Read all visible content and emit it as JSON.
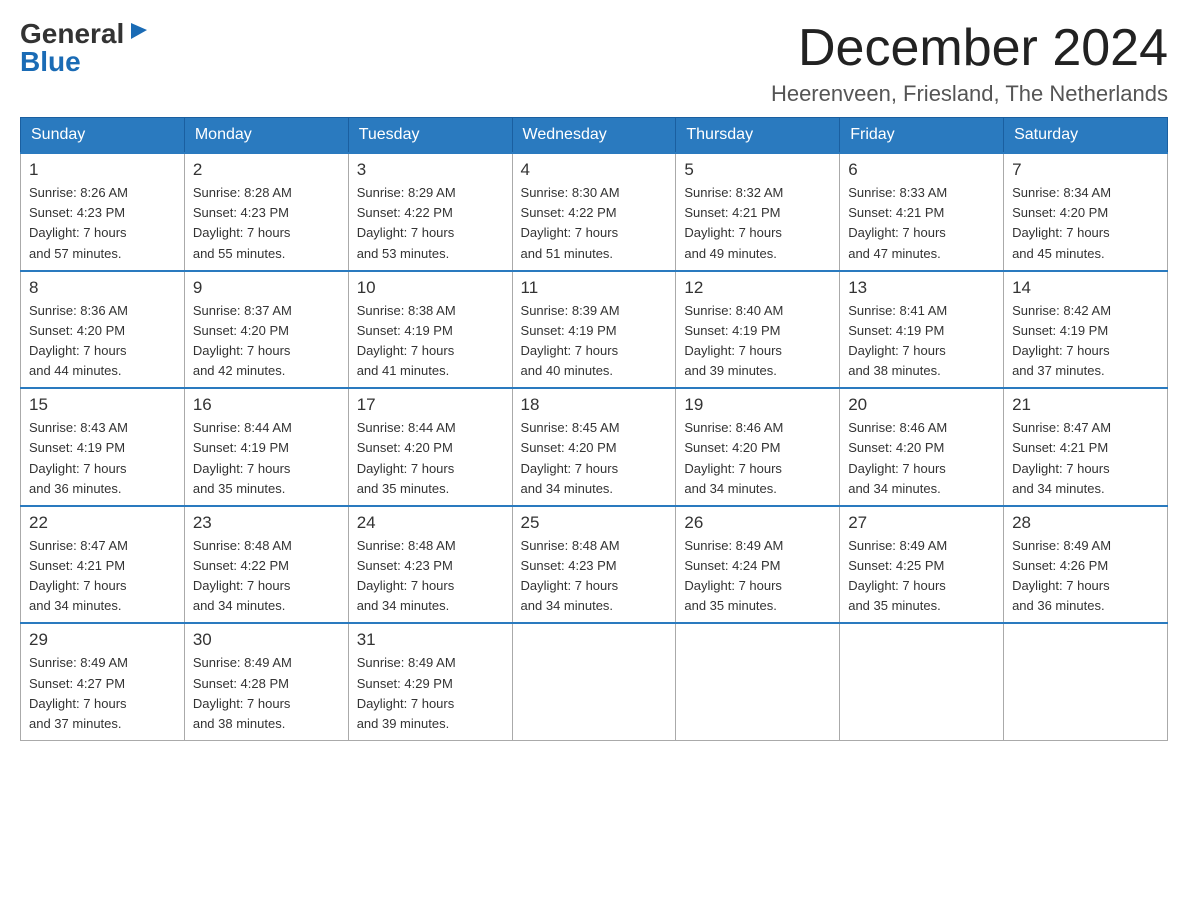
{
  "logo": {
    "general": "General",
    "blue": "Blue",
    "triangle": "▶"
  },
  "title": "December 2024",
  "subtitle": "Heerenveen, Friesland, The Netherlands",
  "headers": [
    "Sunday",
    "Monday",
    "Tuesday",
    "Wednesday",
    "Thursday",
    "Friday",
    "Saturday"
  ],
  "weeks": [
    [
      {
        "day": "1",
        "info": "Sunrise: 8:26 AM\nSunset: 4:23 PM\nDaylight: 7 hours\nand 57 minutes."
      },
      {
        "day": "2",
        "info": "Sunrise: 8:28 AM\nSunset: 4:23 PM\nDaylight: 7 hours\nand 55 minutes."
      },
      {
        "day": "3",
        "info": "Sunrise: 8:29 AM\nSunset: 4:22 PM\nDaylight: 7 hours\nand 53 minutes."
      },
      {
        "day": "4",
        "info": "Sunrise: 8:30 AM\nSunset: 4:22 PM\nDaylight: 7 hours\nand 51 minutes."
      },
      {
        "day": "5",
        "info": "Sunrise: 8:32 AM\nSunset: 4:21 PM\nDaylight: 7 hours\nand 49 minutes."
      },
      {
        "day": "6",
        "info": "Sunrise: 8:33 AM\nSunset: 4:21 PM\nDaylight: 7 hours\nand 47 minutes."
      },
      {
        "day": "7",
        "info": "Sunrise: 8:34 AM\nSunset: 4:20 PM\nDaylight: 7 hours\nand 45 minutes."
      }
    ],
    [
      {
        "day": "8",
        "info": "Sunrise: 8:36 AM\nSunset: 4:20 PM\nDaylight: 7 hours\nand 44 minutes."
      },
      {
        "day": "9",
        "info": "Sunrise: 8:37 AM\nSunset: 4:20 PM\nDaylight: 7 hours\nand 42 minutes."
      },
      {
        "day": "10",
        "info": "Sunrise: 8:38 AM\nSunset: 4:19 PM\nDaylight: 7 hours\nand 41 minutes."
      },
      {
        "day": "11",
        "info": "Sunrise: 8:39 AM\nSunset: 4:19 PM\nDaylight: 7 hours\nand 40 minutes."
      },
      {
        "day": "12",
        "info": "Sunrise: 8:40 AM\nSunset: 4:19 PM\nDaylight: 7 hours\nand 39 minutes."
      },
      {
        "day": "13",
        "info": "Sunrise: 8:41 AM\nSunset: 4:19 PM\nDaylight: 7 hours\nand 38 minutes."
      },
      {
        "day": "14",
        "info": "Sunrise: 8:42 AM\nSunset: 4:19 PM\nDaylight: 7 hours\nand 37 minutes."
      }
    ],
    [
      {
        "day": "15",
        "info": "Sunrise: 8:43 AM\nSunset: 4:19 PM\nDaylight: 7 hours\nand 36 minutes."
      },
      {
        "day": "16",
        "info": "Sunrise: 8:44 AM\nSunset: 4:19 PM\nDaylight: 7 hours\nand 35 minutes."
      },
      {
        "day": "17",
        "info": "Sunrise: 8:44 AM\nSunset: 4:20 PM\nDaylight: 7 hours\nand 35 minutes."
      },
      {
        "day": "18",
        "info": "Sunrise: 8:45 AM\nSunset: 4:20 PM\nDaylight: 7 hours\nand 34 minutes."
      },
      {
        "day": "19",
        "info": "Sunrise: 8:46 AM\nSunset: 4:20 PM\nDaylight: 7 hours\nand 34 minutes."
      },
      {
        "day": "20",
        "info": "Sunrise: 8:46 AM\nSunset: 4:20 PM\nDaylight: 7 hours\nand 34 minutes."
      },
      {
        "day": "21",
        "info": "Sunrise: 8:47 AM\nSunset: 4:21 PM\nDaylight: 7 hours\nand 34 minutes."
      }
    ],
    [
      {
        "day": "22",
        "info": "Sunrise: 8:47 AM\nSunset: 4:21 PM\nDaylight: 7 hours\nand 34 minutes."
      },
      {
        "day": "23",
        "info": "Sunrise: 8:48 AM\nSunset: 4:22 PM\nDaylight: 7 hours\nand 34 minutes."
      },
      {
        "day": "24",
        "info": "Sunrise: 8:48 AM\nSunset: 4:23 PM\nDaylight: 7 hours\nand 34 minutes."
      },
      {
        "day": "25",
        "info": "Sunrise: 8:48 AM\nSunset: 4:23 PM\nDaylight: 7 hours\nand 34 minutes."
      },
      {
        "day": "26",
        "info": "Sunrise: 8:49 AM\nSunset: 4:24 PM\nDaylight: 7 hours\nand 35 minutes."
      },
      {
        "day": "27",
        "info": "Sunrise: 8:49 AM\nSunset: 4:25 PM\nDaylight: 7 hours\nand 35 minutes."
      },
      {
        "day": "28",
        "info": "Sunrise: 8:49 AM\nSunset: 4:26 PM\nDaylight: 7 hours\nand 36 minutes."
      }
    ],
    [
      {
        "day": "29",
        "info": "Sunrise: 8:49 AM\nSunset: 4:27 PM\nDaylight: 7 hours\nand 37 minutes."
      },
      {
        "day": "30",
        "info": "Sunrise: 8:49 AM\nSunset: 4:28 PM\nDaylight: 7 hours\nand 38 minutes."
      },
      {
        "day": "31",
        "info": "Sunrise: 8:49 AM\nSunset: 4:29 PM\nDaylight: 7 hours\nand 39 minutes."
      },
      null,
      null,
      null,
      null
    ]
  ]
}
